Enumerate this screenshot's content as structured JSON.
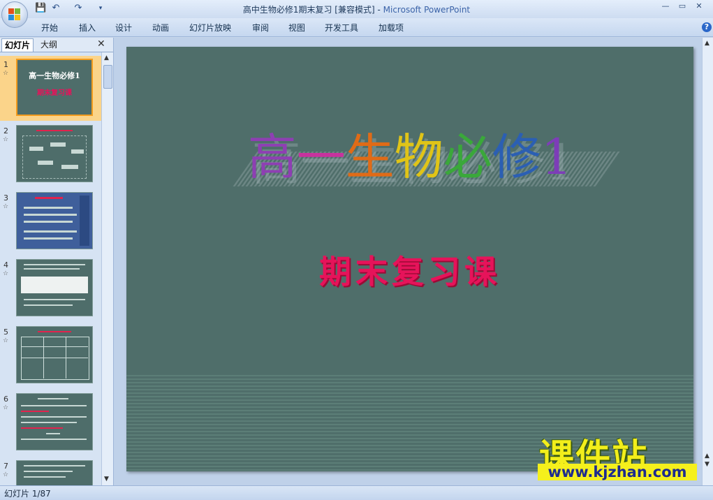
{
  "window": {
    "title": "高中生物必修1期末复习 [兼容模式]",
    "separator": " - ",
    "app_name": "Microsoft PowerPoint",
    "controls": [
      "—",
      "▭",
      "✕"
    ]
  },
  "quick_access": [
    "💾",
    "↶",
    "↷",
    "▾"
  ],
  "ribbon": {
    "tabs": [
      "开始",
      "插入",
      "设计",
      "动画",
      "幻灯片放映",
      "审阅",
      "视图",
      "开发工具",
      "加载项"
    ],
    "help": "?"
  },
  "panel": {
    "tab_slides": "幻灯片",
    "tab_outline": "大纲",
    "close": "✕",
    "slides": [
      {
        "num": "1",
        "selected": true
      },
      {
        "num": "2"
      },
      {
        "num": "3"
      },
      {
        "num": "4"
      },
      {
        "num": "5"
      },
      {
        "num": "6"
      },
      {
        "num": "7"
      }
    ],
    "thumb1": {
      "title": "高一生物必修1",
      "subtitle": "期末复习课"
    }
  },
  "slide": {
    "title_chars": [
      {
        "ch": "高",
        "color": "#8e3fb3"
      },
      {
        "ch": "一",
        "color": "#c8329e"
      },
      {
        "ch": "生",
        "color": "#e06b17"
      },
      {
        "ch": "物",
        "color": "#e0c417"
      },
      {
        "ch": "必",
        "color": "#3aa83a"
      },
      {
        "ch": "修",
        "color": "#2b5fb3"
      },
      {
        "ch": "1",
        "color": "#7d3db8"
      }
    ],
    "subtitle": "期末复习课"
  },
  "watermark": {
    "name": "课件站",
    "url": "www.kjzhan.com"
  },
  "status": {
    "slide_info": "幻灯片 1/87"
  },
  "colors": {
    "slide_bg": "#4f6e6a",
    "subtitle": "#e6135a",
    "accent_selected": "#fbd48a"
  }
}
